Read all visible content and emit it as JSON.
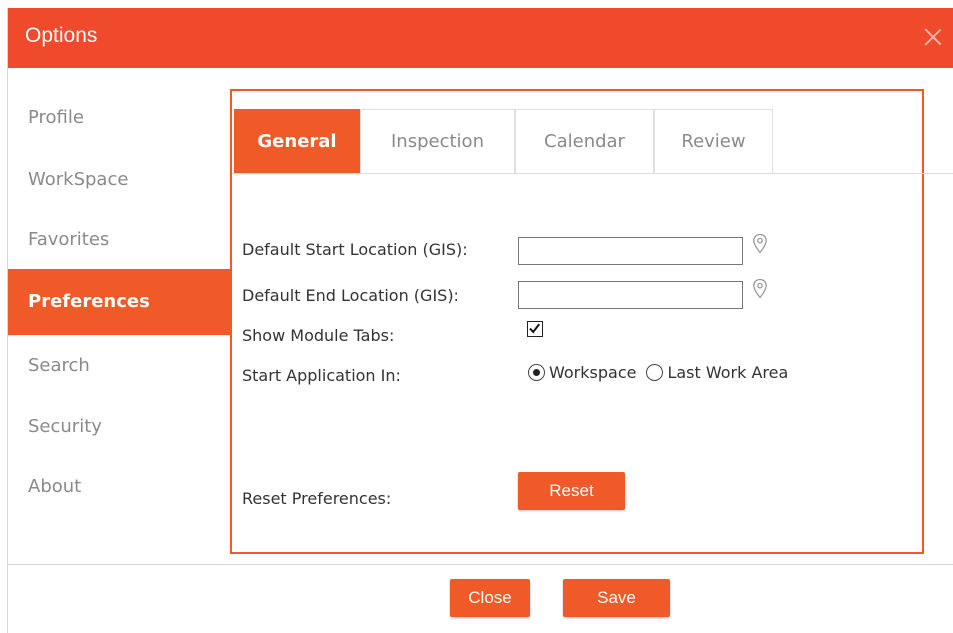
{
  "window": {
    "title": "Options"
  },
  "sidebar": {
    "items": [
      {
        "label": "Profile"
      },
      {
        "label": "WorkSpace"
      },
      {
        "label": "Favorites"
      },
      {
        "label": "Preferences",
        "active": true
      },
      {
        "label": "Search"
      },
      {
        "label": "Security"
      },
      {
        "label": "About"
      }
    ]
  },
  "tabs": [
    {
      "label": "General",
      "active": true
    },
    {
      "label": "Inspection"
    },
    {
      "label": "Calendar"
    },
    {
      "label": "Review"
    }
  ],
  "form": {
    "start_location_label": "Default Start Location (GIS):",
    "start_location_value": "",
    "end_location_label": "Default End Location (GIS):",
    "end_location_value": "",
    "show_module_tabs_label": "Show Module Tabs:",
    "show_module_tabs_checked": true,
    "start_app_label": "Start Application In:",
    "start_app_options": [
      "Workspace",
      "Last Work Area"
    ],
    "start_app_selected": "Workspace",
    "reset_label": "Reset Preferences:",
    "reset_button": "Reset"
  },
  "footer": {
    "close_button": "Close",
    "save_button": "Save"
  },
  "colors": {
    "accent": "#ef5a28",
    "titlebar": "#ef4a2b"
  }
}
